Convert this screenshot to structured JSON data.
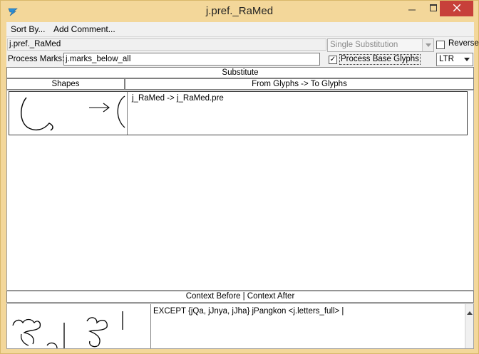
{
  "window": {
    "title": "j.pref._RaMed",
    "controls": {
      "minimize": "minimize-icon",
      "maximize": "maximize-icon",
      "close": "close-icon"
    },
    "close_color": "#c7403a"
  },
  "menu": {
    "sort_by": "Sort By...",
    "add_comment": "Add Comment..."
  },
  "lookup": {
    "name": "j.pref._RaMed",
    "type": "Single Substitution",
    "reverse_label": "Reverse",
    "reverse_checked": false,
    "process_marks_label": "Process Marks:",
    "process_marks_value": "j.marks_below_all",
    "process_base_glyphs_label": "Process Base Glyphs",
    "process_base_glyphs_checked": true,
    "check_mark": "✓",
    "direction": "LTR"
  },
  "headers": {
    "substitute": "Substitute",
    "shapes": "Shapes",
    "from_to": "From Glyphs -> To Glyphs",
    "context": "Context Before | Context After"
  },
  "rules": [
    {
      "text": "j_RaMed -> j_RaMed.pre"
    }
  ],
  "context": {
    "text": "EXCEPT {jQa, jJnya, jJha} jPangkon <j.letters_full> |"
  }
}
